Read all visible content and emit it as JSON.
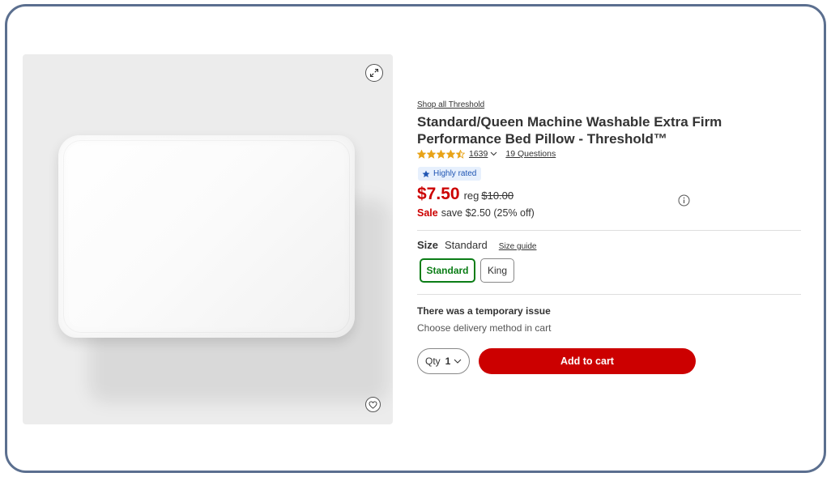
{
  "product": {
    "shop_link": "Shop all Threshold",
    "title": "Standard/Queen Machine Washable Extra Firm Performance Bed Pillow - Threshold™",
    "rating_value": 4.5,
    "rating_max": 5,
    "rating_count": "1639",
    "questions": "19 Questions",
    "badge": "Highly rated"
  },
  "pricing": {
    "price": "$7.50",
    "reg_label": "reg",
    "reg_price": "$10.00",
    "sale_label": "Sale",
    "savings": "save $2.50 (25% off)"
  },
  "size": {
    "label": "Size",
    "selected": "Standard",
    "guide_link": "Size guide",
    "options": [
      "Standard",
      "King"
    ]
  },
  "delivery": {
    "issue_title": "There was a temporary issue",
    "issue_sub": "Choose delivery method in cart"
  },
  "cart": {
    "qty_label": "Qty",
    "qty_value": "1",
    "add_button": "Add to cart"
  },
  "icons": {
    "expand": "expand-icon",
    "favorite": "heart-icon",
    "info": "info-icon",
    "star": "star-icon",
    "chevron": "chevron-down-icon"
  },
  "colors": {
    "accent_red": "#cc0000",
    "selected_green": "#0b7d16",
    "badge_blue": "#1f55b3",
    "star_gold": "#e8a317"
  }
}
